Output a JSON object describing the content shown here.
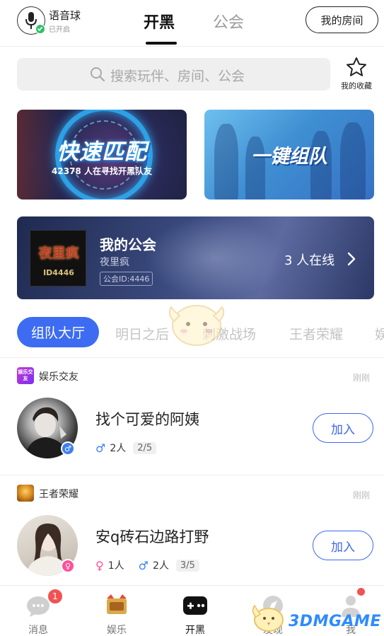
{
  "header": {
    "voice_ball_label": "语音球",
    "voice_ball_status": "已开启",
    "tabs": [
      {
        "label": "开黑",
        "active": true
      },
      {
        "label": "公会",
        "active": false
      }
    ],
    "my_room_button": "我的房间"
  },
  "search": {
    "placeholder": "搜索玩伴、房间、公会",
    "favorites_label": "我的收藏"
  },
  "banners": {
    "quick_match": {
      "title": "快速匹配",
      "subtitle": "42378 人在寻找开黑队友"
    },
    "team_up": {
      "title": "一键组队"
    }
  },
  "guild": {
    "title": "我的公会",
    "name": "夜里疯",
    "id_label": "公会ID:4446",
    "logo_text": "夜里疯",
    "logo_id": "ID4446",
    "online": "3 人在线"
  },
  "categories": [
    {
      "label": "组队大厅",
      "active": true
    },
    {
      "label": "明日之后",
      "active": false
    },
    {
      "label": "刺激战场",
      "active": false
    },
    {
      "label": "王者荣耀",
      "active": false
    },
    {
      "label": "娱",
      "active": false
    }
  ],
  "rooms": [
    {
      "tag": "娱乐交友",
      "tag_icon_text": "娱乐交友",
      "time": "刚刚",
      "title": "找个可爱的阿姨",
      "males": "2人",
      "capacity": "2/5",
      "host_gender_icon": "male-icon",
      "join_label": "加入"
    },
    {
      "tag": "王者荣耀",
      "time": "刚刚",
      "title": "安q砖石边路打野",
      "females": "1人",
      "males": "2人",
      "capacity": "3/5",
      "host_gender_icon": "female-icon",
      "join_label": "加入"
    }
  ],
  "bottom_nav": [
    {
      "label": "消息",
      "icon": "chat-icon",
      "badge": "1",
      "active": false
    },
    {
      "label": "娱乐",
      "icon": "celebration-icon",
      "active": false
    },
    {
      "label": "开黑",
      "icon": "gamepad-icon",
      "active": true
    },
    {
      "label": "发现",
      "icon": "compass-icon",
      "active": false
    },
    {
      "label": "我",
      "icon": "profile-icon",
      "active": false
    }
  ],
  "watermark": "3DMGAME",
  "colors": {
    "accent": "#3d6cf2",
    "join_border": "#4066f0",
    "male": "#3d7ff2",
    "female": "#ff4f9a",
    "badge": "#f25252",
    "voice_on": "#2ec26a"
  }
}
